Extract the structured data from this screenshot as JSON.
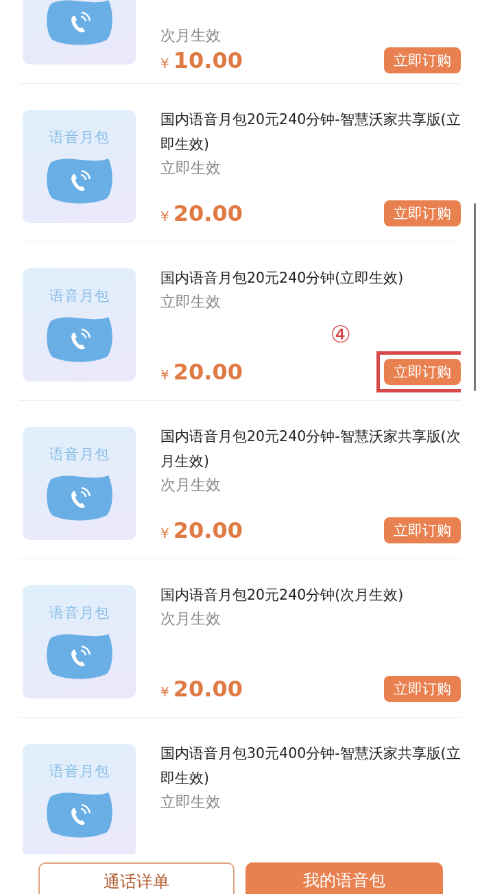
{
  "packages": [
    {
      "subtitle": "次月生效",
      "price": "10.00",
      "currency": "¥",
      "button": "立即订购",
      "highlighted": false
    },
    {
      "thumb_label": "语音月包",
      "title": "国内语音月包20元240分钟-智慧沃家共享版(立即生效)",
      "subtitle": "立即生效",
      "price": "20.00",
      "currency": "¥",
      "button": "立即订购",
      "highlighted": false
    },
    {
      "thumb_label": "语音月包",
      "title": "国内语音月包20元240分钟(立即生效)",
      "subtitle": "立即生效",
      "price": "20.00",
      "currency": "¥",
      "button": "立即订购",
      "highlighted": true,
      "annotation": "④"
    },
    {
      "thumb_label": "语音月包",
      "title": "国内语音月包20元240分钟-智慧沃家共享版(次月生效)",
      "subtitle": "次月生效",
      "price": "20.00",
      "currency": "¥",
      "button": "立即订购",
      "highlighted": false
    },
    {
      "thumb_label": "语音月包",
      "title": "国内语音月包20元240分钟(次月生效)",
      "subtitle": "次月生效",
      "price": "20.00",
      "currency": "¥",
      "button": "立即订购",
      "highlighted": false
    },
    {
      "thumb_label": "语音月包",
      "title": "国内语音月包30元400分钟-智慧沃家共享版(立即生效)",
      "subtitle": "立即生效"
    }
  ],
  "bottom_bar": [
    {
      "kind": "outline",
      "label": "通话详单"
    },
    {
      "kind": "filled",
      "label": "我的语音包"
    }
  ]
}
